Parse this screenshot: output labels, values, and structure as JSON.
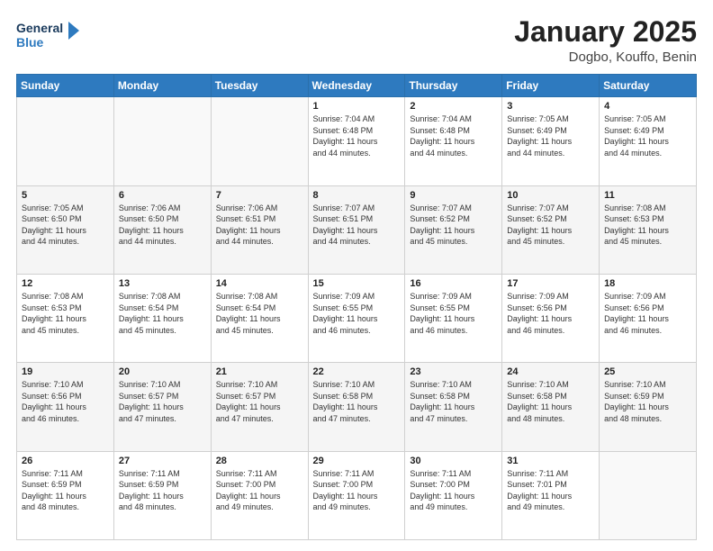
{
  "header": {
    "logo_line1": "General",
    "logo_line2": "Blue",
    "month": "January 2025",
    "location": "Dogbo, Kouffo, Benin"
  },
  "weekdays": [
    "Sunday",
    "Monday",
    "Tuesday",
    "Wednesday",
    "Thursday",
    "Friday",
    "Saturday"
  ],
  "weeks": [
    [
      {
        "day": "",
        "info": ""
      },
      {
        "day": "",
        "info": ""
      },
      {
        "day": "",
        "info": ""
      },
      {
        "day": "1",
        "info": "Sunrise: 7:04 AM\nSunset: 6:48 PM\nDaylight: 11 hours\nand 44 minutes."
      },
      {
        "day": "2",
        "info": "Sunrise: 7:04 AM\nSunset: 6:48 PM\nDaylight: 11 hours\nand 44 minutes."
      },
      {
        "day": "3",
        "info": "Sunrise: 7:05 AM\nSunset: 6:49 PM\nDaylight: 11 hours\nand 44 minutes."
      },
      {
        "day": "4",
        "info": "Sunrise: 7:05 AM\nSunset: 6:49 PM\nDaylight: 11 hours\nand 44 minutes."
      }
    ],
    [
      {
        "day": "5",
        "info": "Sunrise: 7:05 AM\nSunset: 6:50 PM\nDaylight: 11 hours\nand 44 minutes."
      },
      {
        "day": "6",
        "info": "Sunrise: 7:06 AM\nSunset: 6:50 PM\nDaylight: 11 hours\nand 44 minutes."
      },
      {
        "day": "7",
        "info": "Sunrise: 7:06 AM\nSunset: 6:51 PM\nDaylight: 11 hours\nand 44 minutes."
      },
      {
        "day": "8",
        "info": "Sunrise: 7:07 AM\nSunset: 6:51 PM\nDaylight: 11 hours\nand 44 minutes."
      },
      {
        "day": "9",
        "info": "Sunrise: 7:07 AM\nSunset: 6:52 PM\nDaylight: 11 hours\nand 45 minutes."
      },
      {
        "day": "10",
        "info": "Sunrise: 7:07 AM\nSunset: 6:52 PM\nDaylight: 11 hours\nand 45 minutes."
      },
      {
        "day": "11",
        "info": "Sunrise: 7:08 AM\nSunset: 6:53 PM\nDaylight: 11 hours\nand 45 minutes."
      }
    ],
    [
      {
        "day": "12",
        "info": "Sunrise: 7:08 AM\nSunset: 6:53 PM\nDaylight: 11 hours\nand 45 minutes."
      },
      {
        "day": "13",
        "info": "Sunrise: 7:08 AM\nSunset: 6:54 PM\nDaylight: 11 hours\nand 45 minutes."
      },
      {
        "day": "14",
        "info": "Sunrise: 7:08 AM\nSunset: 6:54 PM\nDaylight: 11 hours\nand 45 minutes."
      },
      {
        "day": "15",
        "info": "Sunrise: 7:09 AM\nSunset: 6:55 PM\nDaylight: 11 hours\nand 46 minutes."
      },
      {
        "day": "16",
        "info": "Sunrise: 7:09 AM\nSunset: 6:55 PM\nDaylight: 11 hours\nand 46 minutes."
      },
      {
        "day": "17",
        "info": "Sunrise: 7:09 AM\nSunset: 6:56 PM\nDaylight: 11 hours\nand 46 minutes."
      },
      {
        "day": "18",
        "info": "Sunrise: 7:09 AM\nSunset: 6:56 PM\nDaylight: 11 hours\nand 46 minutes."
      }
    ],
    [
      {
        "day": "19",
        "info": "Sunrise: 7:10 AM\nSunset: 6:56 PM\nDaylight: 11 hours\nand 46 minutes."
      },
      {
        "day": "20",
        "info": "Sunrise: 7:10 AM\nSunset: 6:57 PM\nDaylight: 11 hours\nand 47 minutes."
      },
      {
        "day": "21",
        "info": "Sunrise: 7:10 AM\nSunset: 6:57 PM\nDaylight: 11 hours\nand 47 minutes."
      },
      {
        "day": "22",
        "info": "Sunrise: 7:10 AM\nSunset: 6:58 PM\nDaylight: 11 hours\nand 47 minutes."
      },
      {
        "day": "23",
        "info": "Sunrise: 7:10 AM\nSunset: 6:58 PM\nDaylight: 11 hours\nand 47 minutes."
      },
      {
        "day": "24",
        "info": "Sunrise: 7:10 AM\nSunset: 6:58 PM\nDaylight: 11 hours\nand 48 minutes."
      },
      {
        "day": "25",
        "info": "Sunrise: 7:10 AM\nSunset: 6:59 PM\nDaylight: 11 hours\nand 48 minutes."
      }
    ],
    [
      {
        "day": "26",
        "info": "Sunrise: 7:11 AM\nSunset: 6:59 PM\nDaylight: 11 hours\nand 48 minutes."
      },
      {
        "day": "27",
        "info": "Sunrise: 7:11 AM\nSunset: 6:59 PM\nDaylight: 11 hours\nand 48 minutes."
      },
      {
        "day": "28",
        "info": "Sunrise: 7:11 AM\nSunset: 7:00 PM\nDaylight: 11 hours\nand 49 minutes."
      },
      {
        "day": "29",
        "info": "Sunrise: 7:11 AM\nSunset: 7:00 PM\nDaylight: 11 hours\nand 49 minutes."
      },
      {
        "day": "30",
        "info": "Sunrise: 7:11 AM\nSunset: 7:00 PM\nDaylight: 11 hours\nand 49 minutes."
      },
      {
        "day": "31",
        "info": "Sunrise: 7:11 AM\nSunset: 7:01 PM\nDaylight: 11 hours\nand 49 minutes."
      },
      {
        "day": "",
        "info": ""
      }
    ]
  ]
}
